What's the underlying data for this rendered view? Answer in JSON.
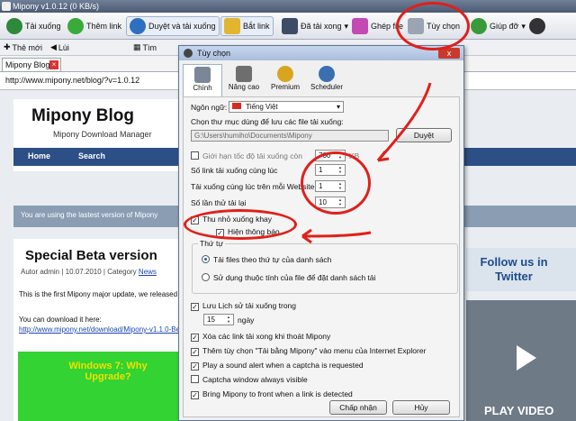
{
  "window": {
    "title": "Mipony v1.0.12 (0 KB/s)"
  },
  "toolbar": {
    "downloads": "Tải xuống",
    "add_link": "Thêm link",
    "browse_download": "Duyệt và tải xuống",
    "catch_link": "Bắt link",
    "finished": "Đã tải xong",
    "merge": "Ghép file",
    "options": "Tùy chọn",
    "help": "Giúp đỡ"
  },
  "navbar": {
    "new": "Thẻ mới",
    "back": "Lùi",
    "search": "Tìm"
  },
  "tabs": [
    {
      "label": "Mipony Blog"
    }
  ],
  "address": "http://www.mipony.net/blog/?v=1.0.12",
  "blog": {
    "title": "Mipony Blog",
    "subtitle": "Mipony Download Manager",
    "menu": [
      "Home",
      "Search"
    ],
    "notice": "You are using the lastest version of Mipony",
    "post_title": "Special Beta version",
    "post_meta": "Autor admin | 10.07.2010 | Category",
    "post_category": "News",
    "p1": "This is the first Mipony major update, we released it",
    "p2": "You can download it here:",
    "p3": "http://www.mipony.net/download/Mipony-v1.1.0-Be",
    "promo": "Windows 7: Why Upgrade?",
    "follow": "Follow us in Twitter",
    "video_label": "PLAY VIDEO"
  },
  "dialog": {
    "title": "Tùy chọn",
    "close_label": "x",
    "tabs": [
      "Chính",
      "Nâng cao",
      "Premium",
      "Scheduler"
    ],
    "language_label": "Ngôn ngữ:",
    "language_value": "Tiếng Việt",
    "folder_label": "Chọn thư mục dùng để lưu các file tải xuống:",
    "folder_value": "G:\\Users\\humiho\\Documents\\Mipony",
    "browse_button": "Duyệt",
    "speed_limit_label": "Giới hạn tốc độ tải xuống còn",
    "speed_limit_value": "700",
    "speed_unit": "KB",
    "simul_links_label": "Số link tải xuống cùng lúc",
    "simul_links_value": "1",
    "per_site_label": "Tải xuống cùng lúc trên mỗi Website",
    "per_site_value": "1",
    "retries_label": "Số lần thử tải lại",
    "retries_value": "10",
    "minimize_tray": "Thu nhỏ xuống khay",
    "show_notify": "Hiện thông báo",
    "order_legend": "Thứ tự",
    "order_list": "Tải files theo thứ tự của danh sách",
    "order_rule": "Sử dụng thuộc tính của file để đặt danh sách tải",
    "keep_history": "Lưu Lịch sử tải xuống trong",
    "history_days_value": "15",
    "days_unit": "ngày",
    "remove_links": "Xóa các link tải xong khi thoát Mipony",
    "ie_menu": "Thêm tùy chọn \"Tải bằng Mipony\" vào menu của Internet Explorer",
    "sound_alert": "Play a sound alert when a captcha is requested",
    "captcha_visible": "Captcha window always visible",
    "bring_front": "Bring Mipony to front when a link is detected",
    "ok_button": "Chấp nhận",
    "cancel_button": "Hủy"
  }
}
